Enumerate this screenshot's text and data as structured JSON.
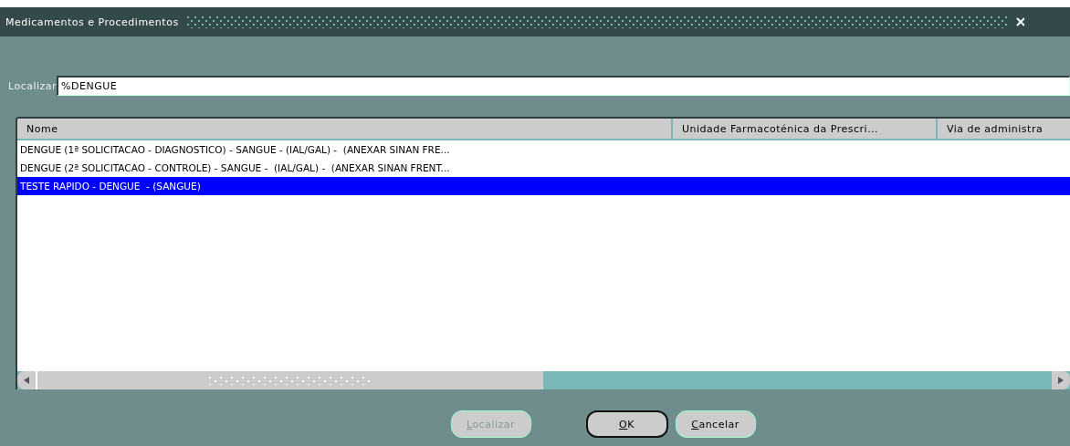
{
  "window": {
    "title": "Medicamentos e Procedimentos"
  },
  "search": {
    "label": "Localizar",
    "value": "%DENGUE"
  },
  "table": {
    "columns": [
      "Nome",
      "Unidade Farmacoténica da Prescri...",
      "Via de administra"
    ],
    "rows": [
      {
        "cells": [
          "DENGUE (1ª SOLICITACAO - DIAGNOSTICO) - SANGUE - (IAL/GAL) -  (ANEXAR SINAN FRE...",
          "",
          ""
        ],
        "selected": false
      },
      {
        "cells": [
          "DENGUE (2ª SOLICITACAO - CONTROLE) - SANGUE -  (IAL/GAL) -  (ANEXAR SINAN FRENT...",
          "",
          ""
        ],
        "selected": false
      },
      {
        "cells": [
          "TESTE RAPIDO - DENGUE  - (SANGUE)",
          "",
          ""
        ],
        "selected": true
      }
    ]
  },
  "buttons": [
    {
      "label": "Localizar",
      "disabled": true,
      "default": false
    },
    {
      "label": "OK",
      "disabled": false,
      "default": true
    },
    {
      "label": "Cancelar",
      "disabled": false,
      "default": false
    }
  ]
}
